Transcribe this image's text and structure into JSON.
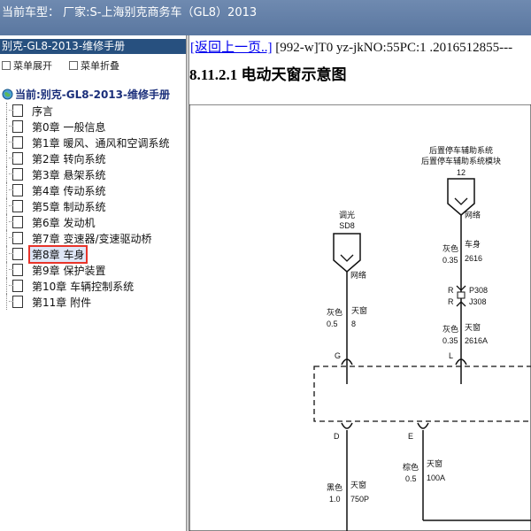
{
  "topbar": {
    "title": "当前车型：  厂家:S-上海别克商务车（GL8）2013"
  },
  "sidebar": {
    "title": "别克-GL8-2013-维修手册",
    "expand_label": "菜单展开",
    "collapse_label": "菜单折叠",
    "root_label": "当前:别克-GL8-2013-维修手册",
    "items": [
      {
        "label": "序言"
      },
      {
        "label": "第0章 一般信息"
      },
      {
        "label": "第1章 暖风、通风和空调系统"
      },
      {
        "label": "第2章 转向系统"
      },
      {
        "label": "第3章 悬架系统"
      },
      {
        "label": "第4章 传动系统"
      },
      {
        "label": "第5章 制动系统"
      },
      {
        "label": "第6章 发动机"
      },
      {
        "label": "第7章 变速器/变速驱动桥"
      },
      {
        "label": "第8章 车身"
      },
      {
        "label": "第9章 保护装置"
      },
      {
        "label": "第10章 车辆控制系统"
      },
      {
        "label": "第11章 附件"
      }
    ],
    "selected_index": 9
  },
  "content": {
    "back_link": "[返回上一页..]",
    "doc_id": " [992-w]T0 yz-jkNO:55PC:1 .2016512855---",
    "heading": "8.11.2.1 电动天窗示意图",
    "diagram": {
      "module_line1": "后置停车辅助系统",
      "module_line2": "后置停车辅助系统模块",
      "module_pin": "12",
      "dimmer_label": "调光",
      "dimmer_pin": "SD8",
      "network_left": "网络",
      "network_right": "网络",
      "wire1_color": "灰色",
      "wire1_size": "0.35",
      "wire1_circuit": "车身",
      "wire1_num": "2616",
      "conn_r1": "R",
      "conn_r2": "R",
      "conn_p308": "P308",
      "conn_j308": "J308",
      "wire2_color": "灰色",
      "wire2_size": "0.5",
      "wire2_circuit": "天窗",
      "wire2_num": "8",
      "wire3_color": "灰色",
      "wire3_size": "0.35",
      "wire3_circuit": "天窗",
      "wire3_num": "2616A",
      "pin_g": "G",
      "pin_l": "L",
      "pin_d": "D",
      "pin_e": "E",
      "wire4_color": "棕色",
      "wire4_size": "0.5",
      "wire4_circuit": "天窗",
      "wire4_num": "100A",
      "wire5_color": "黑色",
      "wire5_size": "1.0",
      "wire5_circuit": "天窗",
      "wire5_num": "750P"
    }
  }
}
